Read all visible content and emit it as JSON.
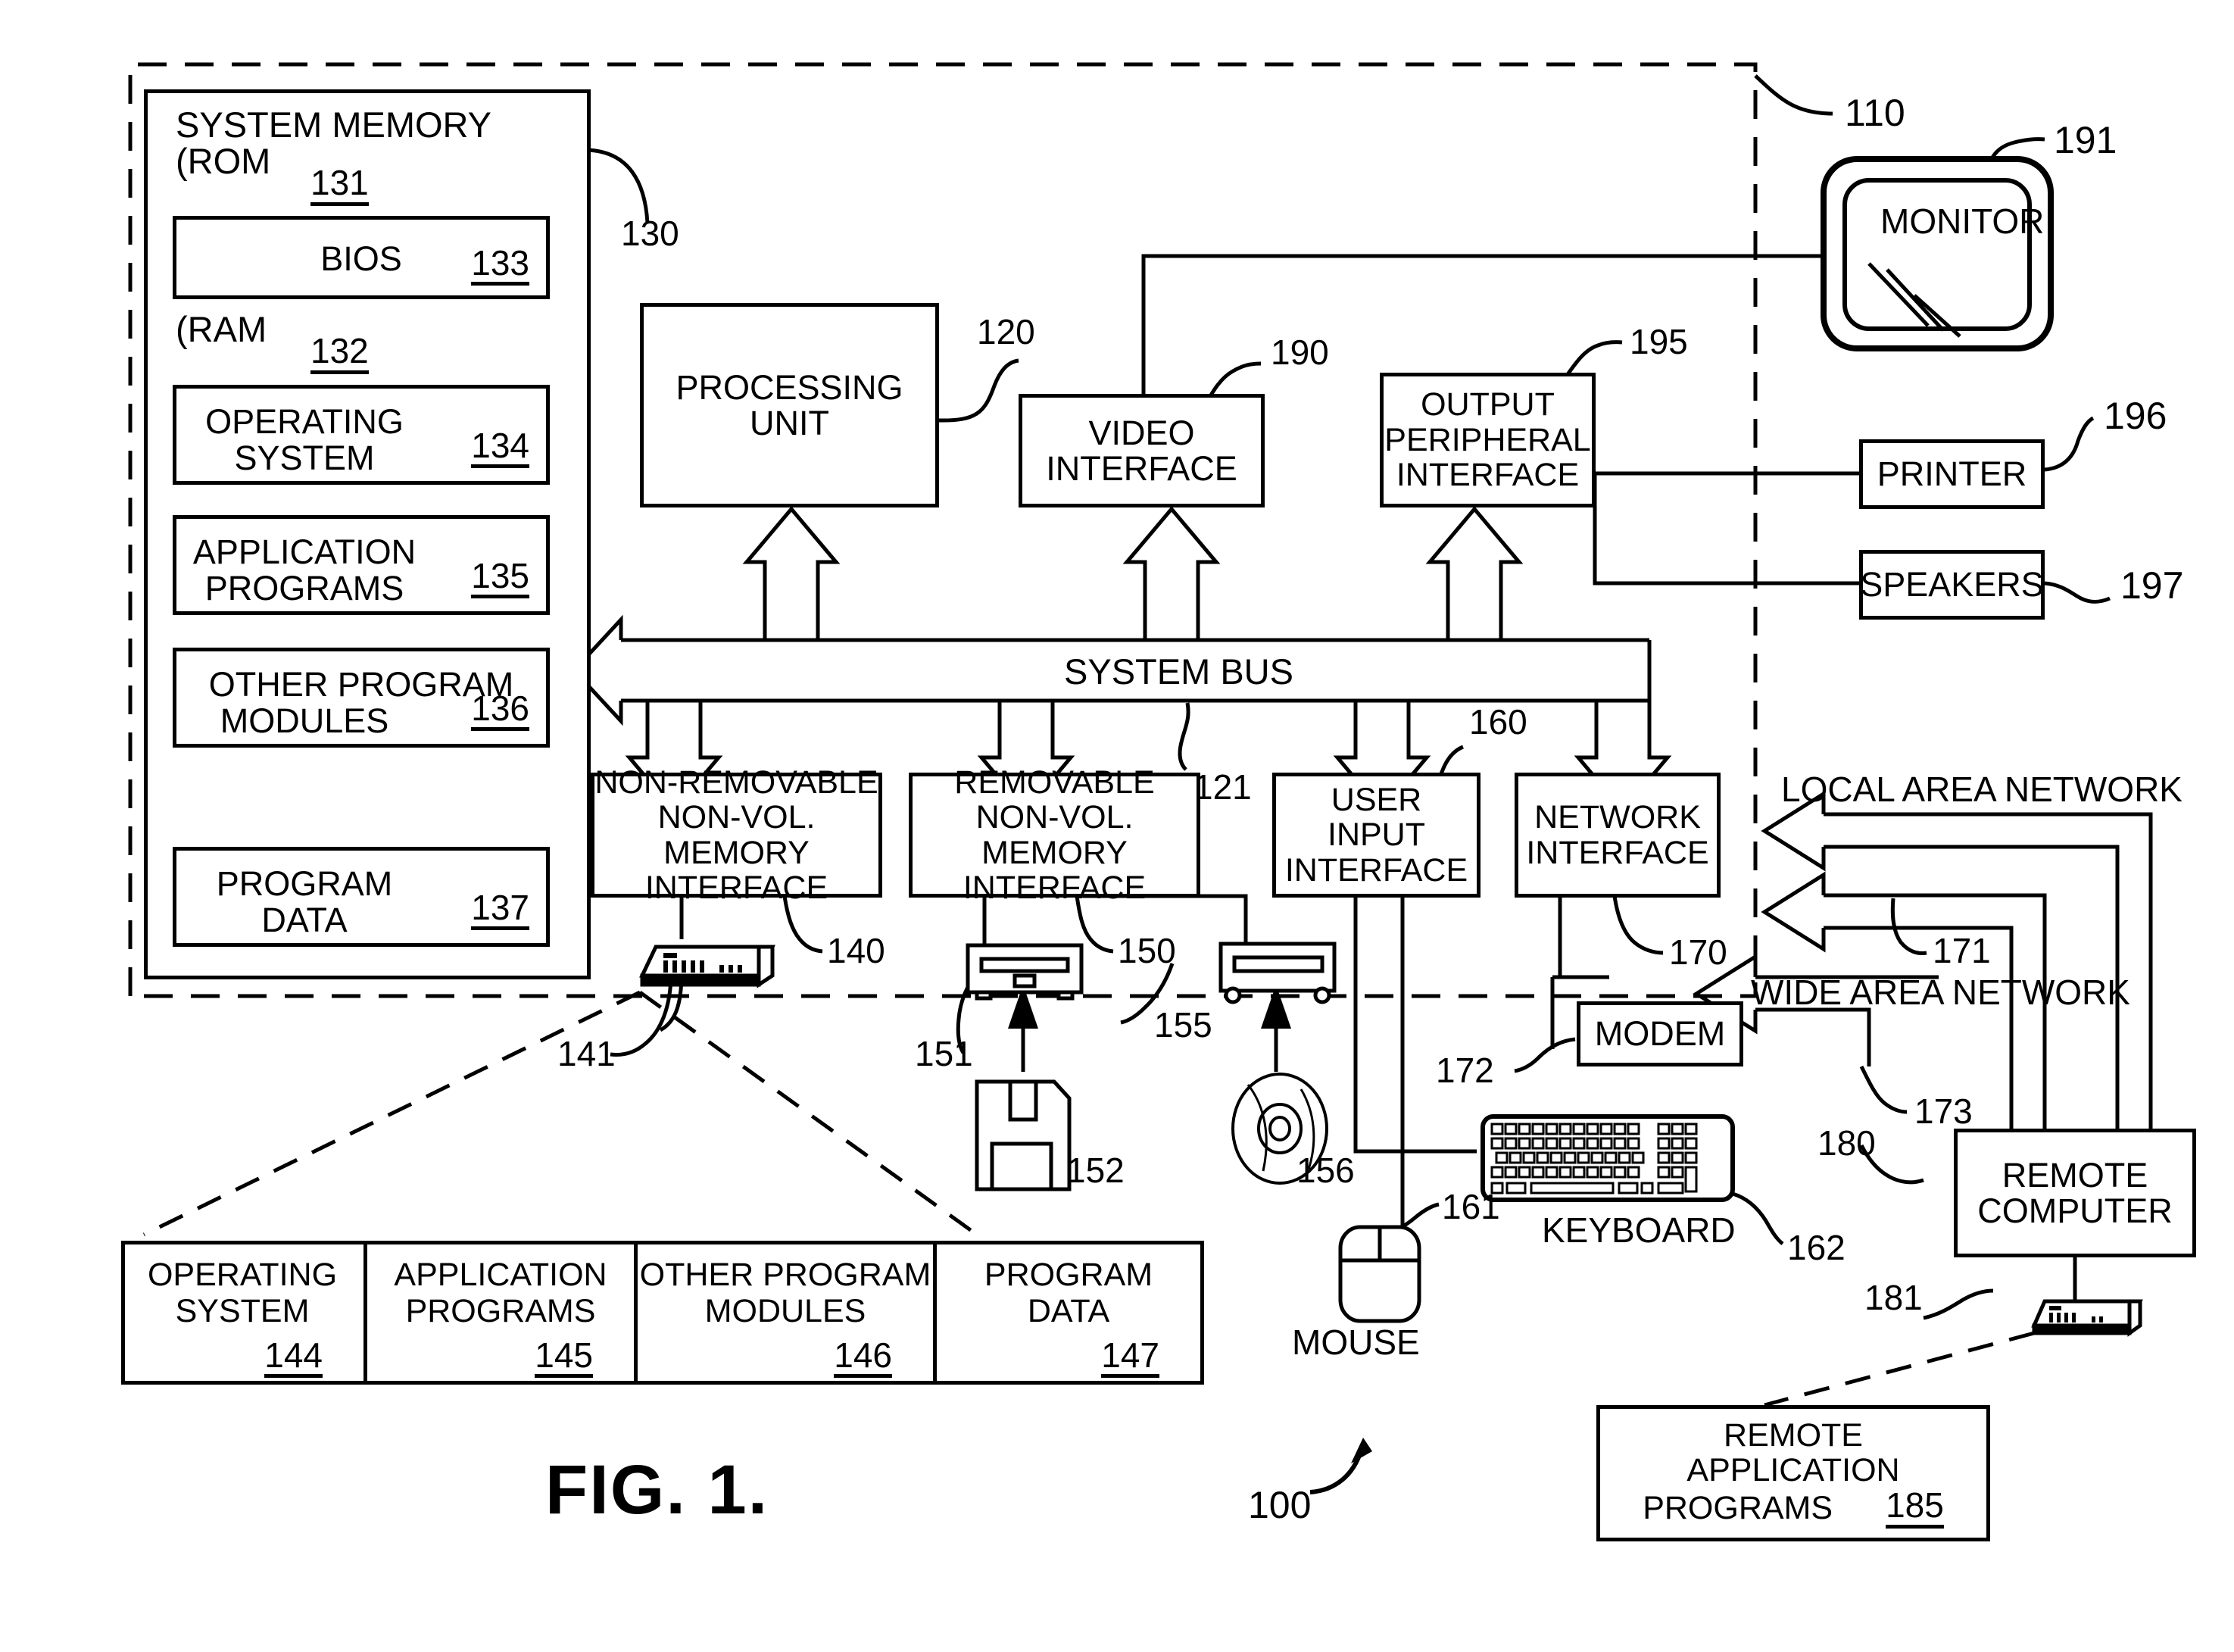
{
  "figure": {
    "caption": "FIG. 1.",
    "system_ref": "100"
  },
  "computer": {
    "boundary_ref": "110",
    "system_memory": {
      "title": "SYSTEM MEMORY",
      "ref": "130",
      "rom": {
        "label": "(ROM",
        "ref": "131"
      },
      "ram": {
        "label": "(RAM",
        "ref": "132"
      },
      "items": [
        {
          "name": "bios",
          "lines": [
            "BIOS"
          ],
          "ref": "133"
        },
        {
          "name": "operating-system",
          "lines": [
            "OPERATING",
            "SYSTEM"
          ],
          "ref": "134"
        },
        {
          "name": "application-programs",
          "lines": [
            "APPLICATION",
            "PROGRAMS"
          ],
          "ref": "135"
        },
        {
          "name": "other-program-modules",
          "lines": [
            "OTHER PROGRAM",
            "MODULES"
          ],
          "ref": "136"
        },
        {
          "name": "program-data",
          "lines": [
            "PROGRAM",
            "DATA"
          ],
          "ref": "137"
        }
      ]
    },
    "processing_unit": {
      "lines": [
        "PROCESSING",
        "UNIT"
      ],
      "ref": "120"
    },
    "system_bus": {
      "label": "SYSTEM BUS",
      "ref": "121"
    },
    "video_interface": {
      "lines": [
        "VIDEO",
        "INTERFACE"
      ],
      "ref": "190"
    },
    "output_peripheral_interface": {
      "lines": [
        "OUTPUT",
        "PERIPHERAL",
        "INTERFACE"
      ],
      "ref": "195"
    },
    "non_removable_interface": {
      "lines": [
        "NON-REMOVABLE",
        "NON-VOL. MEMORY",
        "INTERFACE"
      ],
      "ref": "140"
    },
    "removable_interface": {
      "lines": [
        "REMOVABLE",
        "NON-VOL. MEMORY",
        "INTERFACE"
      ],
      "ref": "150"
    },
    "user_input_interface": {
      "lines": [
        "USER",
        "INPUT",
        "INTERFACE"
      ],
      "ref": "160"
    },
    "network_interface": {
      "lines": [
        "NETWORK",
        "INTERFACE"
      ],
      "ref": "170"
    }
  },
  "peripherals": {
    "monitor": {
      "label": "MONITOR",
      "ref": "191"
    },
    "printer": {
      "label": "PRINTER",
      "ref": "196"
    },
    "speakers": {
      "label": "SPEAKERS",
      "ref": "197"
    },
    "keyboard": {
      "label": "KEYBOARD",
      "ref": "162"
    },
    "mouse": {
      "label": "MOUSE",
      "ref": "161"
    },
    "hard_disk": {
      "ref": "141"
    },
    "floppy_drive": {
      "ref": "151"
    },
    "floppy_disk": {
      "ref": "152"
    },
    "optical_drive": {
      "ref": "155"
    },
    "optical_disc": {
      "ref": "156"
    },
    "modem": {
      "label": "MODEM",
      "ref": "172"
    }
  },
  "network": {
    "lan": {
      "label": "LOCAL AREA NETWORK",
      "ref": "171"
    },
    "wan": {
      "label": "WIDE AREA NETWORK",
      "ref": "173"
    },
    "remote_computer": {
      "lines": [
        "REMOTE",
        "COMPUTER"
      ],
      "ref": "180"
    },
    "remote_hard_disk": {
      "ref": "181"
    },
    "remote_application_programs": {
      "lines": [
        "REMOTE",
        "APPLICATION",
        "PROGRAMS"
      ],
      "ref": "185"
    }
  },
  "storage_table": {
    "cells": [
      {
        "lines": [
          "OPERATING",
          "SYSTEM"
        ],
        "ref": "144"
      },
      {
        "lines": [
          "APPLICATION",
          "PROGRAMS"
        ],
        "ref": "145"
      },
      {
        "lines": [
          "OTHER PROGRAM",
          "MODULES"
        ],
        "ref": "146"
      },
      {
        "lines": [
          "PROGRAM",
          "DATA"
        ],
        "ref": "147"
      }
    ]
  },
  "colors": {
    "ink": "#000000",
    "paper": "#ffffff"
  }
}
